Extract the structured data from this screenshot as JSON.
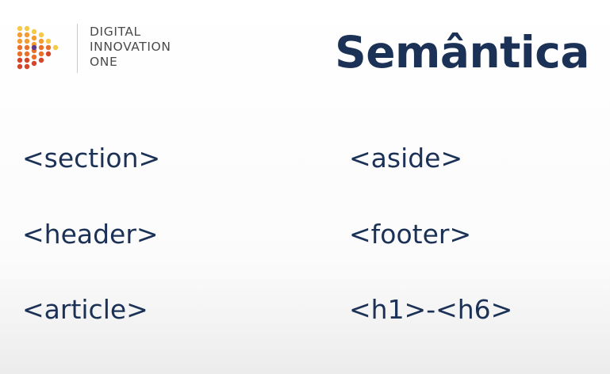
{
  "brand": {
    "line1": "DIGITAL",
    "line2": "INNOVATION",
    "line3": "ONE",
    "mark_colors": [
      "#f7c948",
      "#f39c33",
      "#e8702a",
      "#d4452a",
      "#5b3b8c"
    ]
  },
  "slide": {
    "title": "Semântica",
    "tags_left": [
      "<section>",
      "<header>",
      "<article>"
    ],
    "tags_right": [
      "<aside>",
      "<footer>",
      "<h1>-<h6>"
    ],
    "text_color": "#1c3156"
  }
}
